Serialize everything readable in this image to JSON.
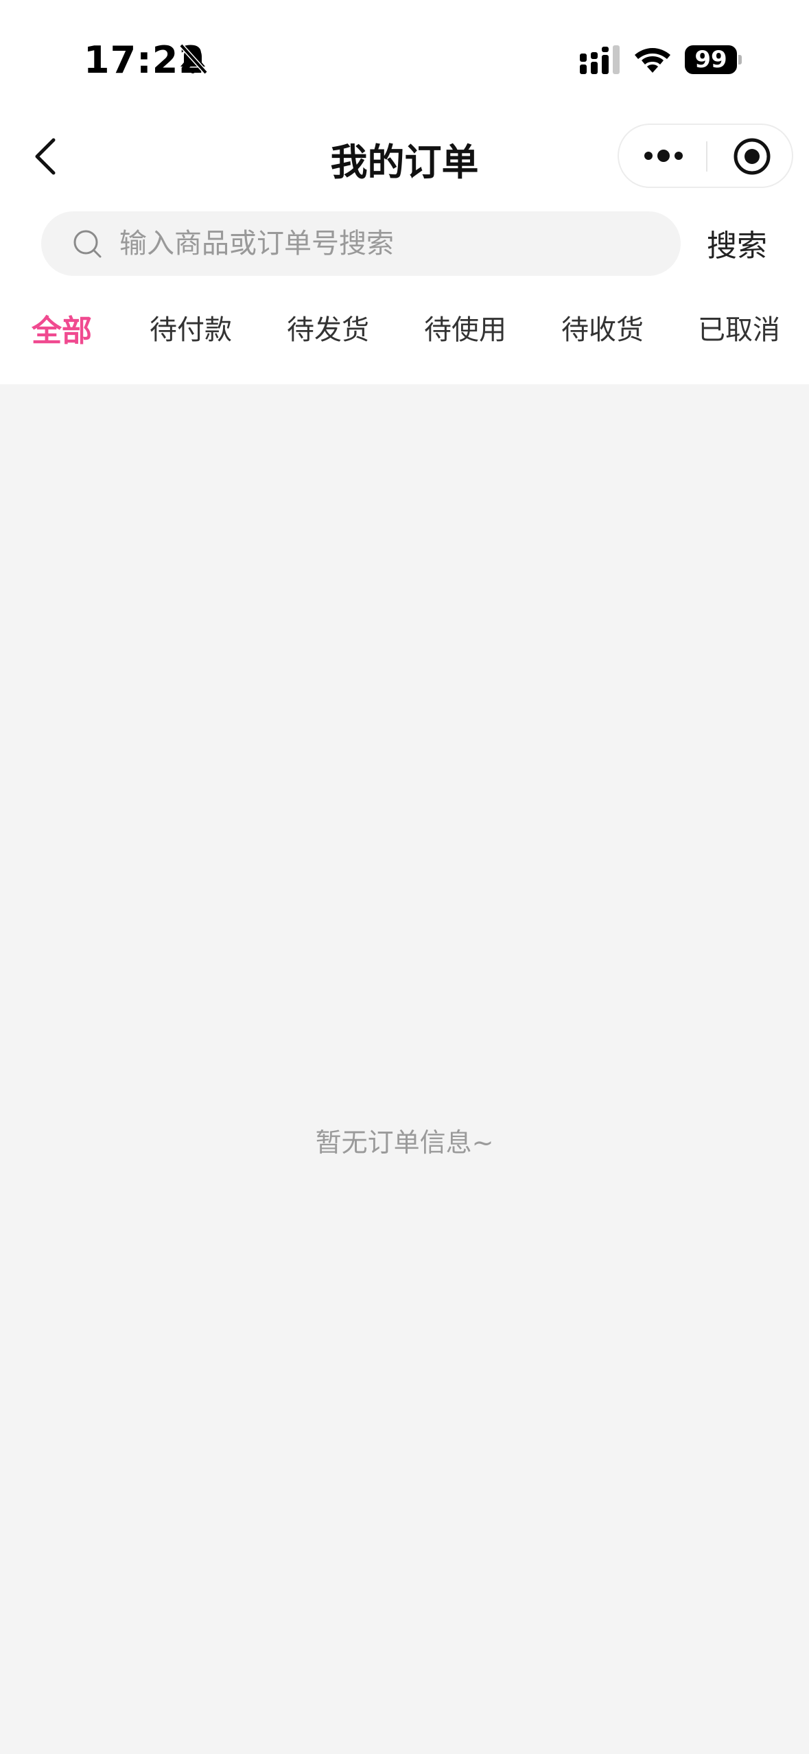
{
  "status_bar": {
    "time": "17:22",
    "battery": "99",
    "icons": [
      "bell-off-icon",
      "signal-icon",
      "wifi-icon",
      "battery-icon"
    ]
  },
  "nav": {
    "title": "我的订单",
    "back_icon": "chevron-left-icon",
    "more_icon": "more-dots-icon",
    "close_icon": "target-icon"
  },
  "search": {
    "placeholder": "输入商品或订单号搜索",
    "value": "",
    "button_label": "搜索",
    "icon": "search-icon"
  },
  "tabs": [
    {
      "label": "全部",
      "active": true
    },
    {
      "label": "待付款",
      "active": false
    },
    {
      "label": "待发货",
      "active": false
    },
    {
      "label": "待使用",
      "active": false
    },
    {
      "label": "待收货",
      "active": false
    },
    {
      "label": "已取消",
      "active": false
    }
  ],
  "empty_state": {
    "message": "暂无订单信息~"
  },
  "colors": {
    "accent": "#f04a90",
    "background": "#f4f4f4",
    "header_background": "#ffffff"
  }
}
